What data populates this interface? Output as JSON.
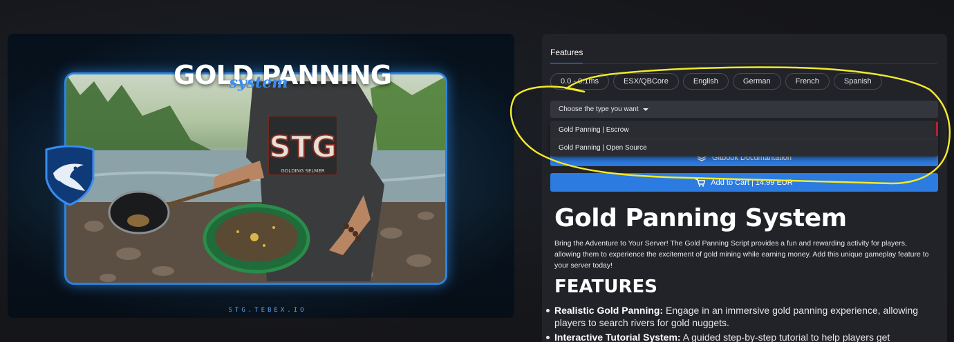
{
  "hero": {
    "title": "GOLD PANNING",
    "subtitle": "system",
    "shirt_text": "STG",
    "shirt_subtext": "GOLDING SELMER",
    "footer": "STG.TEBEX.IO"
  },
  "panel": {
    "tab": "Features",
    "tags": [
      "0.0 - 0.1ms",
      "ESX/QBCore",
      "English",
      "German",
      "French",
      "Spanish"
    ],
    "select": {
      "label": "Choose the type you want"
    },
    "menu": [
      "Gold Panning | Escrow",
      "Gold Panning | Open Source"
    ],
    "doc_button": "Gitbook Documantation",
    "cart_button": "Add to Cart | 14.99 EUR",
    "product_title": "Gold Panning System",
    "description": "Bring the Adventure to Your Server! The Gold Panning Script provides a fun and rewarding activity for players, allowing them to experience the excitement of gold mining while earning money. Add this unique gameplay feature to your server today!",
    "features_heading": "FEATURES",
    "features": [
      {
        "name": "Realistic Gold Panning:",
        "text": " Engage in an immersive gold panning experience, allowing players to search rivers for gold nuggets."
      },
      {
        "name": "Interactive Tutorial System:",
        "text": " A guided step-by-step tutorial to help players get"
      }
    ]
  },
  "colors": {
    "accent": "#2c7be0",
    "annotation": "#f2ea2a",
    "panel_bg": "#222329"
  },
  "icons": [
    "shield-eagle-logo",
    "gitbook-icon",
    "cart-icon",
    "chevron-down-icon"
  ]
}
